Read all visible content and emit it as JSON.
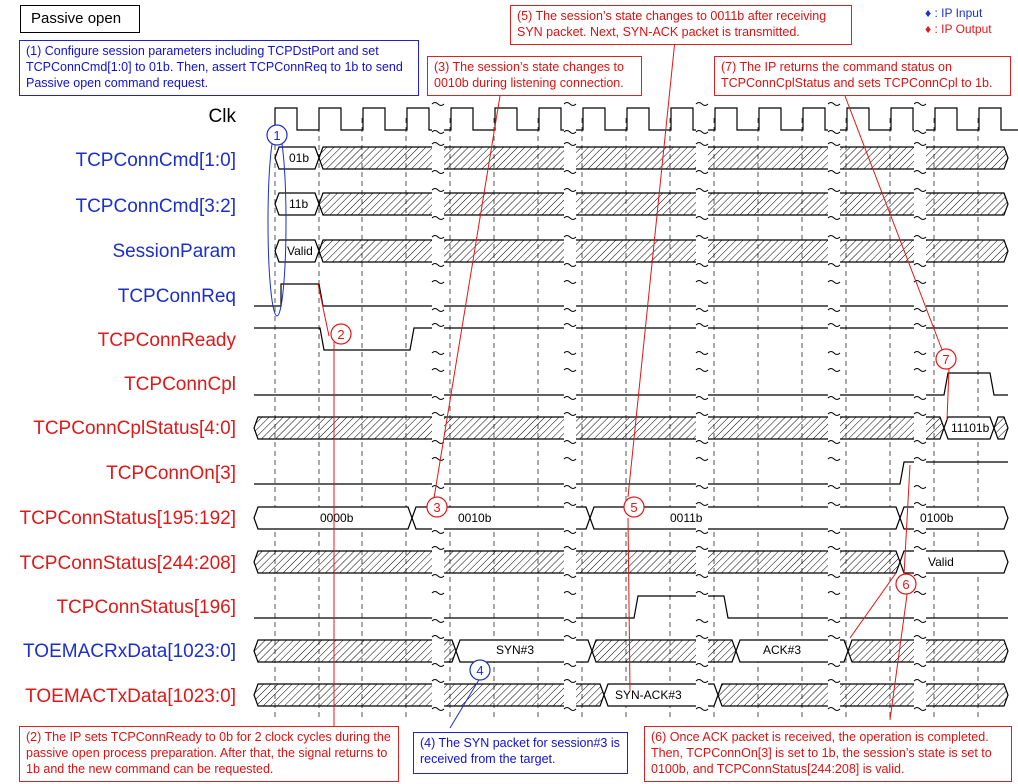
{
  "title": "Passive open",
  "legend": {
    "input_symbol": "♦",
    "input_label": ": IP Input",
    "output_symbol": "♦",
    "output_label": ": IP Output",
    "input_color": "#1b2fcc",
    "output_color": "#e01818"
  },
  "signals": [
    {
      "id": "clk",
      "name": "Clk",
      "kind": "clock"
    },
    {
      "id": "cmd10",
      "name": "TCPConnCmd[1:0]",
      "kind": "input"
    },
    {
      "id": "cmd32",
      "name": "TCPConnCmd[3:2]",
      "kind": "input"
    },
    {
      "id": "param",
      "name": "SessionParam",
      "kind": "input"
    },
    {
      "id": "req",
      "name": "TCPConnReq",
      "kind": "input"
    },
    {
      "id": "ready",
      "name": "TCPConnReady",
      "kind": "output"
    },
    {
      "id": "cpl",
      "name": "TCPConnCpl",
      "kind": "output"
    },
    {
      "id": "cplstatus",
      "name": "TCPConnCplStatus[4:0]",
      "kind": "output"
    },
    {
      "id": "connon",
      "name": "TCPConnOn[3]",
      "kind": "output"
    },
    {
      "id": "status195",
      "name": "TCPConnStatus[195:192]",
      "kind": "output"
    },
    {
      "id": "status244",
      "name": "TCPConnStatus[244:208]",
      "kind": "output"
    },
    {
      "id": "status196",
      "name": "TCPConnStatus[196]",
      "kind": "output"
    },
    {
      "id": "rxdata",
      "name": "TOEMACRxData[1023:0]",
      "kind": "input"
    },
    {
      "id": "txdata",
      "name": "TOEMACTxData[1023:0]",
      "kind": "output"
    }
  ],
  "values": {
    "cmd10": "01b",
    "cmd32": "11b",
    "param": "Valid",
    "cplstatus": "11101b",
    "status195_a": "0000b",
    "status195_b": "0010b",
    "status195_c": "0011b",
    "status195_d": "0100b",
    "status244": "Valid",
    "rx_syn": "SYN#3",
    "rx_ack": "ACK#3",
    "tx_synack": "SYN-ACK#3"
  },
  "markers": [
    "1",
    "2",
    "3",
    "4",
    "5",
    "6",
    "7"
  ],
  "notes": {
    "n1": "(1) Configure session parameters including TCPDstPort and set TCPConnCmd[1:0] to 01b. Then, assert TCPConnReq to 1b to send Passive open command request.",
    "n2": "(2) The IP sets TCPConnReady to 0b for 2 clock cycles during the passive open process preparation. After that, the signal returns to 1b and the new command can be requested.",
    "n3": "(3) The session’s state changes to 0010b during listening connection.",
    "n4": "(4) The SYN packet for session#3 is received from the target.",
    "n5": "(5) The session’s state changes to 0011b after receiving SYN packet. Next, SYN-ACK packet is transmitted.",
    "n6": "(6) Once ACK packet is received, the operation is completed. Then, TCPConnOn[3] is set to 1b, the session’s state is set to 0100b, and TCPConnStatus[244:208] is valid.",
    "n7": "(7) The IP returns the command status on TCPConnCplStatus and sets TCPConnCpl to 1b."
  }
}
